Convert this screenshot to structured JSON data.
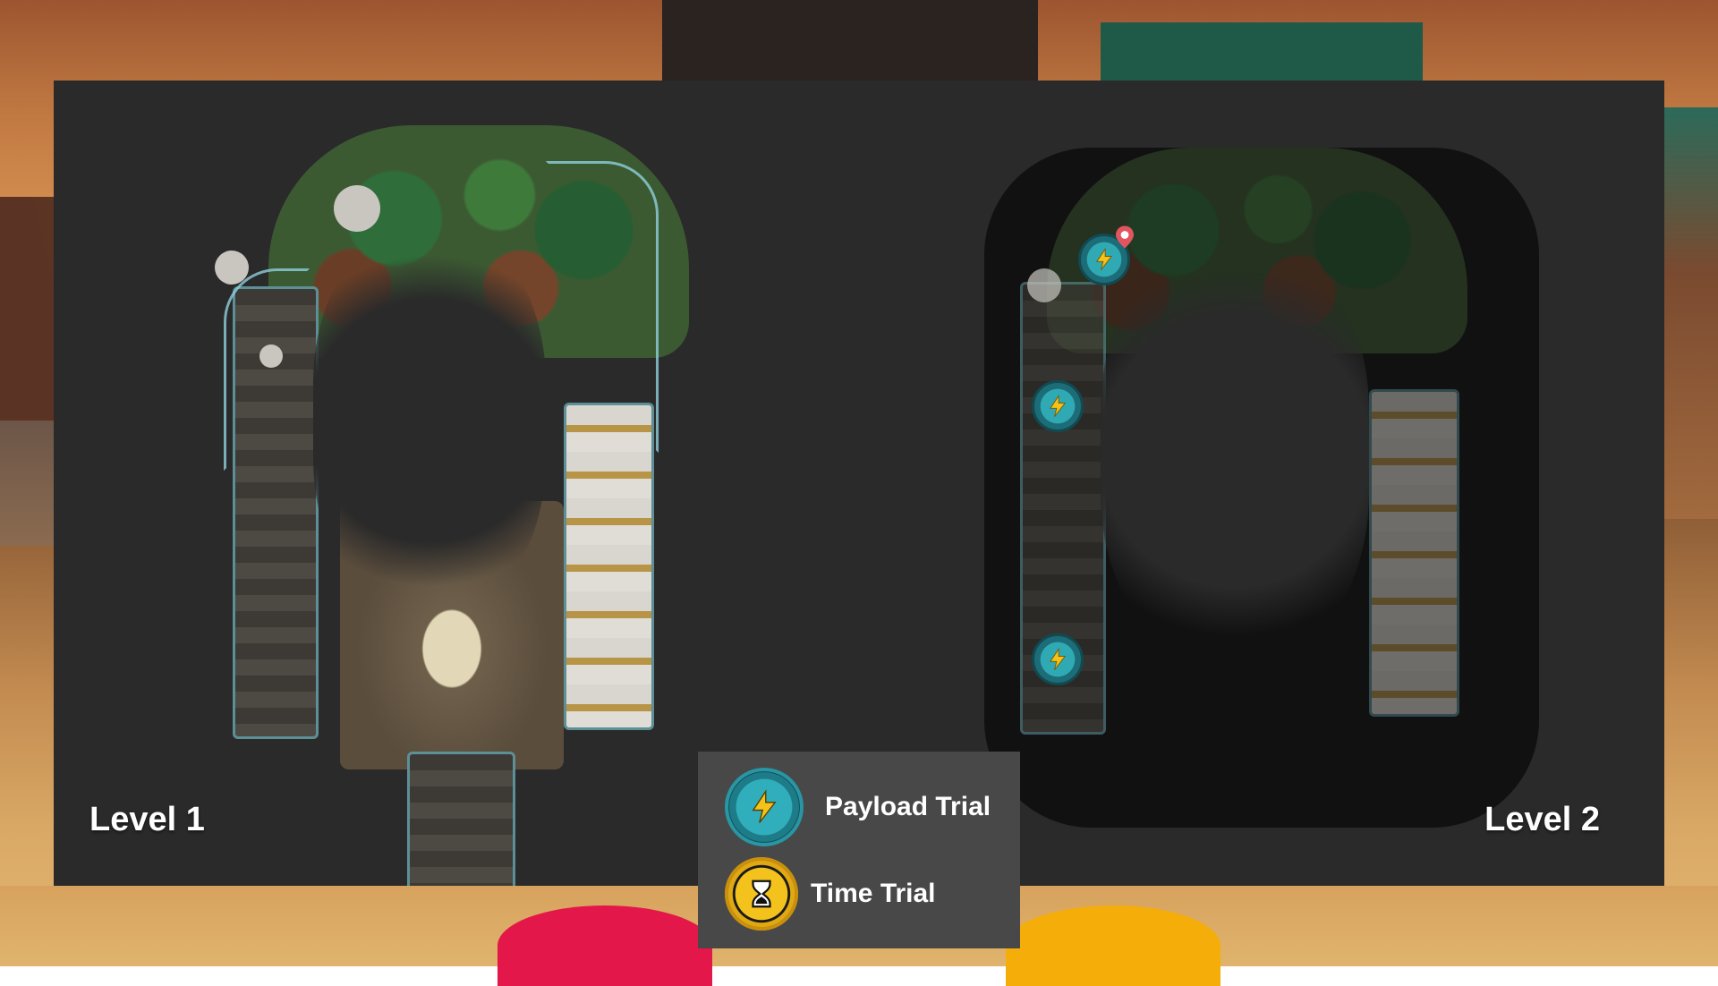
{
  "levels": [
    {
      "label": "Level 1"
    },
    {
      "label": "Level 2"
    }
  ],
  "legend": {
    "items": [
      {
        "label": "Payload Trial",
        "icon": "lightning-medallion-icon",
        "color": "#31aebb"
      },
      {
        "label": "Time Trial",
        "icon": "hourglass-medallion-icon",
        "color": "#f4c21c"
      }
    ]
  },
  "colors": {
    "panel": "#2a2a2a",
    "legend_bg": "#484848",
    "payload_teal": "#31aebb",
    "time_gold": "#f4c21c",
    "player_pin": "#e05560"
  }
}
